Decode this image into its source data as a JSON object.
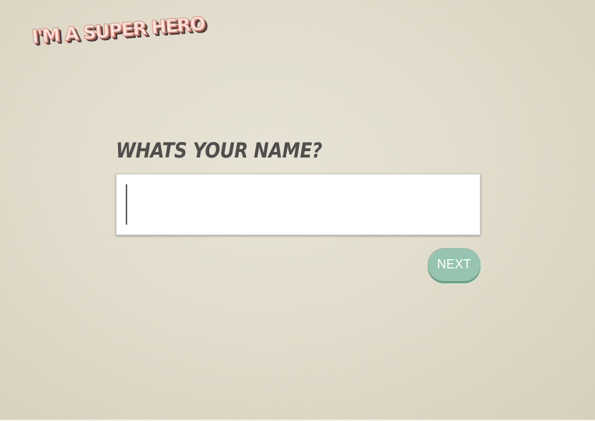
{
  "app": {
    "logo_text": "I'M A SUPER HERO"
  },
  "form": {
    "question": "WHATS YOUR NAME?",
    "name_input": {
      "value": "",
      "placeholder": ""
    },
    "next_label": "NEXT"
  },
  "colors": {
    "background": "#e2ddcc",
    "question_text": "#4f4e4c",
    "logo_fill": "#fbe5df",
    "logo_outline": "#e58f80",
    "button_bg": "#96c4b0",
    "button_shadow": "#6e9d89",
    "button_text": "#ffffff"
  }
}
